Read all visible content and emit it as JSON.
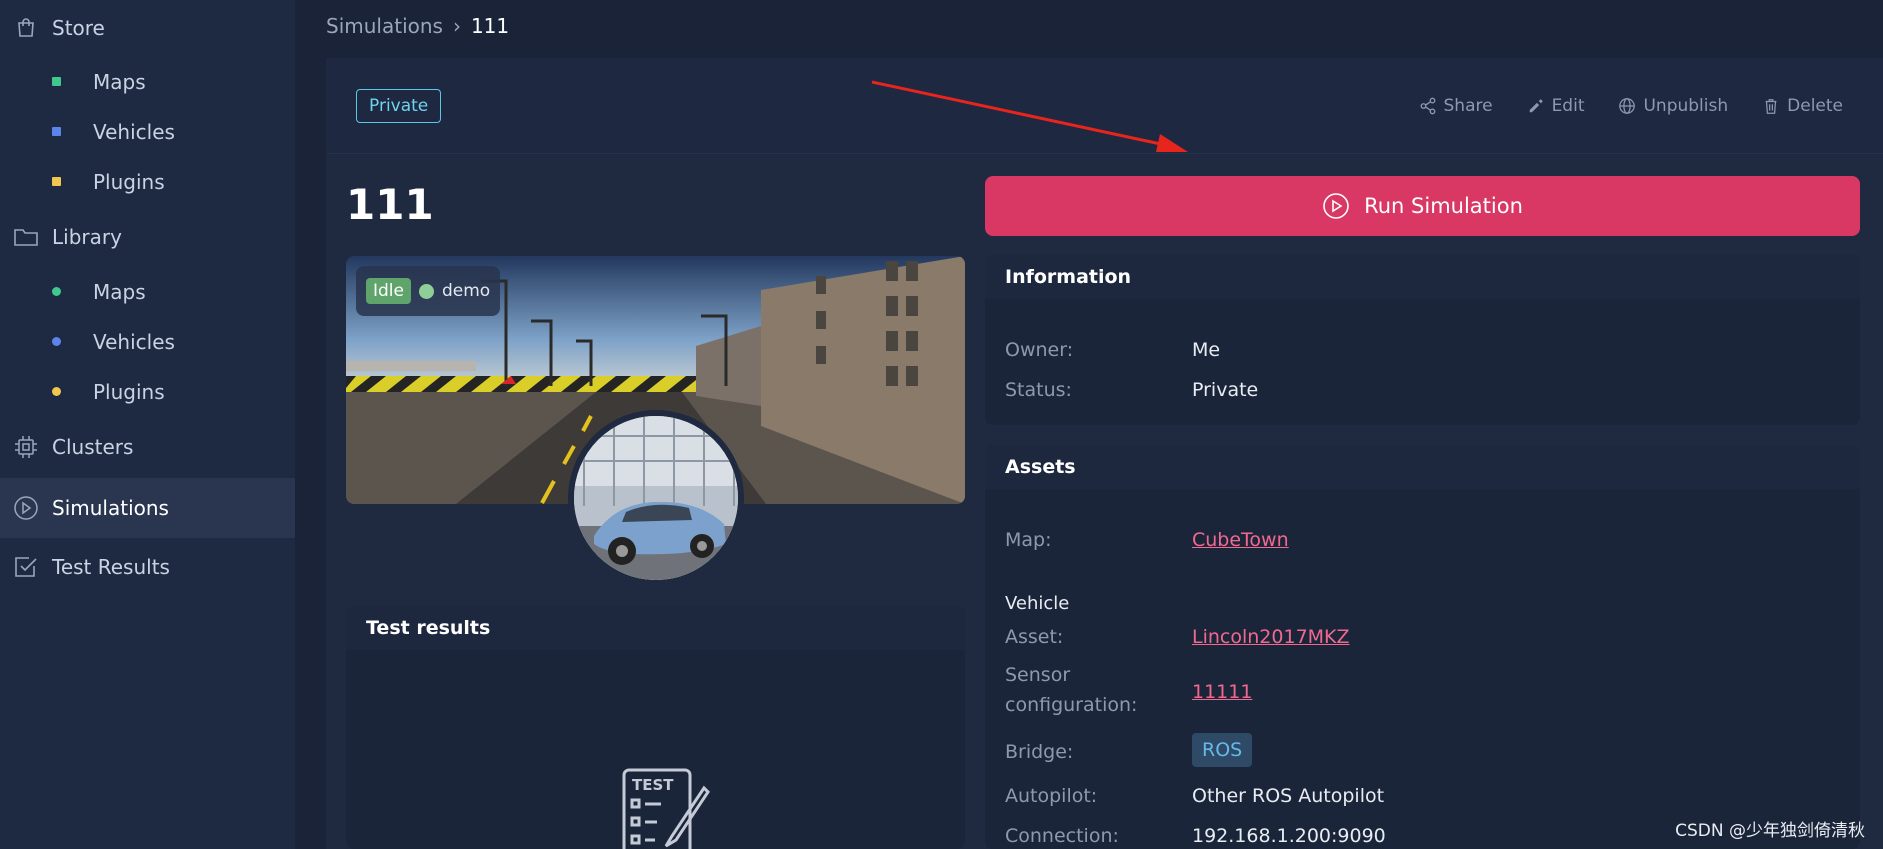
{
  "sidebar": {
    "items": [
      {
        "label": "Store",
        "icon": "shopping-bag-icon"
      },
      {
        "label": "Maps",
        "dot": "#3fc98e"
      },
      {
        "label": "Vehicles",
        "dot": "#5b85ea"
      },
      {
        "label": "Plugins",
        "dot": "#f0c64e"
      },
      {
        "label": "Library",
        "icon": "folder-icon"
      },
      {
        "label": "Maps",
        "dot": "#3fc98e"
      },
      {
        "label": "Vehicles",
        "dot": "#5b85ea"
      },
      {
        "label": "Plugins",
        "dot": "#f0c64e"
      },
      {
        "label": "Clusters",
        "icon": "cpu-chip-icon"
      },
      {
        "label": "Simulations",
        "icon": "play-circle-icon"
      },
      {
        "label": "Test Results",
        "icon": "checkbox-icon"
      }
    ]
  },
  "breadcrumb": {
    "parent": "Simulations",
    "sep": "›",
    "current": "111"
  },
  "header": {
    "badge": "Private",
    "actions": {
      "share": "Share",
      "edit": "Edit",
      "unpublish": "Unpublish",
      "delete": "Delete"
    }
  },
  "simulation": {
    "title": "111",
    "status": "Idle",
    "cluster": "demo"
  },
  "run_button": "Run Simulation",
  "information": {
    "title": "Information",
    "owner_label": "Owner:",
    "owner": "Me",
    "status_label": "Status:",
    "status": "Private"
  },
  "assets": {
    "title": "Assets",
    "map_label": "Map:",
    "map": "CubeTown",
    "vehicle_heading": "Vehicle",
    "asset_label": "Asset:",
    "asset": "Lincoln2017MKZ",
    "sensor_label_1": "Sensor",
    "sensor_label_2": "configuration:",
    "sensor": "11111",
    "bridge_label": "Bridge:",
    "bridge": "ROS",
    "autopilot_label": "Autopilot:",
    "autopilot": "Other ROS Autopilot",
    "connection_label": "Connection:",
    "connection": "192.168.1.200:9090"
  },
  "test_results": {
    "title": "Test results",
    "illustration_text": "TEST"
  },
  "watermark": "CSDN @少年独剑倚清秋",
  "colors": {
    "accent": "#d93764",
    "link": "#f2698f",
    "badge": "#6fd3f0",
    "idle": "#5fa46a"
  }
}
